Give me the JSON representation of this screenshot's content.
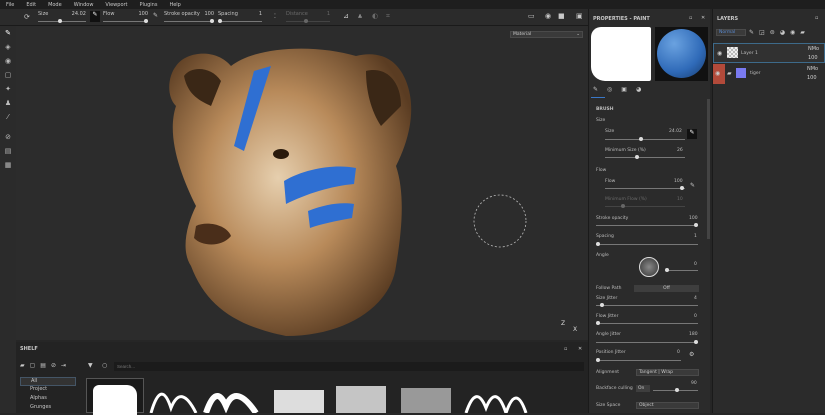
{
  "menu": [
    "File",
    "Edit",
    "Mode",
    "Window",
    "Viewport",
    "Plugins",
    "Help"
  ],
  "toolbar": {
    "size_label": "Size",
    "size_value": "24.02",
    "flow_label": "Flow",
    "flow_value": "100",
    "stroke_opacity_label": "Stroke opacity",
    "stroke_opacity_value": "100",
    "spacing_label": "Spacing",
    "spacing_value": "1",
    "distance_label": "Distance",
    "distance_value": "1"
  },
  "viewport": {
    "channel_select": "Material",
    "axis_z": "Z",
    "axis_x": "X"
  },
  "properties": {
    "title": "PROPERTIES - PAINT",
    "section": "BRUSH",
    "size_group": "Size",
    "size_label": "Size",
    "size_value": "24.02",
    "size_pct": 0.42,
    "min_size_label": "Minimum Size (%)",
    "min_size_value": "26",
    "min_size_pct": 0.26,
    "flow_group": "Flow",
    "flow_label": "Flow",
    "flow_value": "100",
    "flow_pct": 1,
    "min_flow_label": "Minimum Flow (%)",
    "min_flow_value": "10",
    "stroke_opacity_label": "Stroke opacity",
    "stroke_opacity_value": "100",
    "spacing_label": "Spacing",
    "spacing_value": "1",
    "angle_label": "Angle",
    "angle_value": "0",
    "follow_path_label": "Follow Path",
    "follow_path_value": "Off",
    "size_jitter_label": "Size Jitter",
    "size_jitter_value": "4",
    "flow_jitter_label": "Flow Jitter",
    "flow_jitter_value": "0",
    "angle_jitter_label": "Angle Jitter",
    "angle_jitter_value": "180",
    "position_jitter_label": "Position Jitter",
    "position_jitter_value": "0",
    "alignment_label": "Alignment",
    "alignment_value": "Tangent | Wrap",
    "backface_label": "Backface culling",
    "backface_value": "On",
    "backface_angle": "90",
    "size_space_label": "Size Space",
    "size_space_value": "Object",
    "colors": {
      "accent_blue": "#3a78c8"
    }
  },
  "layers": {
    "title": "LAYERS",
    "blend_mode": "Normal",
    "items": [
      {
        "name": "Layer 1",
        "blend": "NMo",
        "opacity": "100"
      },
      {
        "name": "tiger",
        "blend": "NMo",
        "opacity": "100"
      }
    ]
  },
  "shelf": {
    "title": "SHELF",
    "search_placeholder": "Search...",
    "categories": [
      "All",
      "Project",
      "Alphas",
      "Grunges"
    ]
  }
}
